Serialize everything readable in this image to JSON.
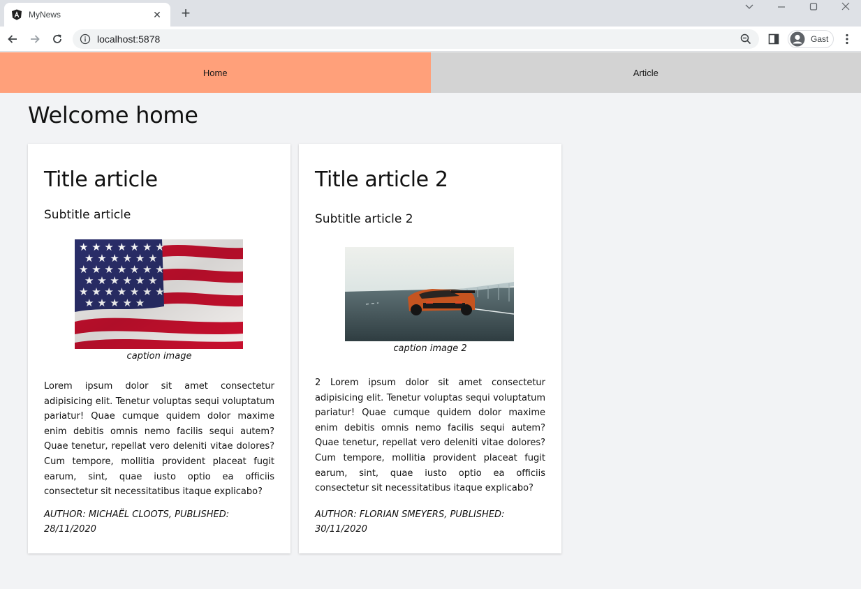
{
  "browser": {
    "tab_title": "MyNews",
    "url": "localhost:5878",
    "profile_name": "Gast"
  },
  "nav": {
    "home_label": "Home",
    "article_label": "Article"
  },
  "page": {
    "title": "Welcome home"
  },
  "articles": [
    {
      "title": "Title article",
      "subtitle": "Subtitle article",
      "caption": "caption image",
      "body": "Lorem ipsum dolor sit amet consectetur adipisicing elit. Tenetur voluptas sequi voluptatum pariatur! Quae cumque quidem dolor maxime enim debitis omnis nemo facilis sequi autem? Quae tenetur, repellat vero deleniti vitae dolores? Cum tempore, mollitia provident placeat fugit earum, sint, quae iusto optio ea officiis consectetur sit necessitatibus itaque explicabo?",
      "meta": "Author: Michaël Cloots, published: 28/11/2020"
    },
    {
      "title": "Title article 2",
      "subtitle": "Subtitle article 2",
      "caption": "caption image 2",
      "body": "2 Lorem ipsum dolor sit amet consectetur adipisicing elit. Tenetur voluptas sequi voluptatum pariatur! Quae cumque quidem dolor maxime enim debitis omnis nemo facilis sequi autem? Quae tenetur, repellat vero deleniti vitae dolores? Cum tempore, mollitia provident placeat fugit earum, sint, quae iusto optio ea officiis consectetur sit necessitatibus itaque explicabo?",
      "meta": "Author: Florian Smeyers, published: 30/11/2020"
    }
  ],
  "colors": {
    "nav_home_active": "#ffa07a",
    "nav_inactive": "#d3d3d3",
    "page_bg": "#f2f3f5"
  }
}
